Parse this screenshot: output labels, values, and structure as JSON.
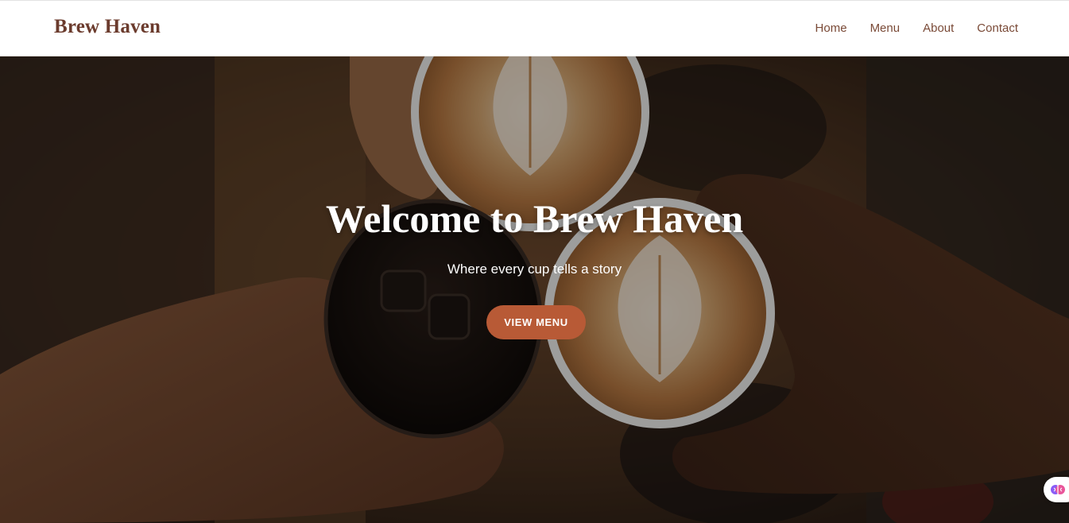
{
  "header": {
    "brand": "Brew Haven",
    "nav": [
      {
        "label": "Home"
      },
      {
        "label": "Menu"
      },
      {
        "label": "About"
      },
      {
        "label": "Contact"
      }
    ]
  },
  "hero": {
    "title": "Welcome to Brew Haven",
    "subtitle": "Where every cup tells a story",
    "cta_label": "VIEW MENU",
    "image_description_icon": "coffee-cups-photo"
  },
  "widget": {
    "icon": "brain-icon"
  },
  "colors": {
    "brand": "#6b3b2d",
    "nav_text": "#7a4a37",
    "cta_background": "#b85a36",
    "hero_text": "#ffffff"
  }
}
